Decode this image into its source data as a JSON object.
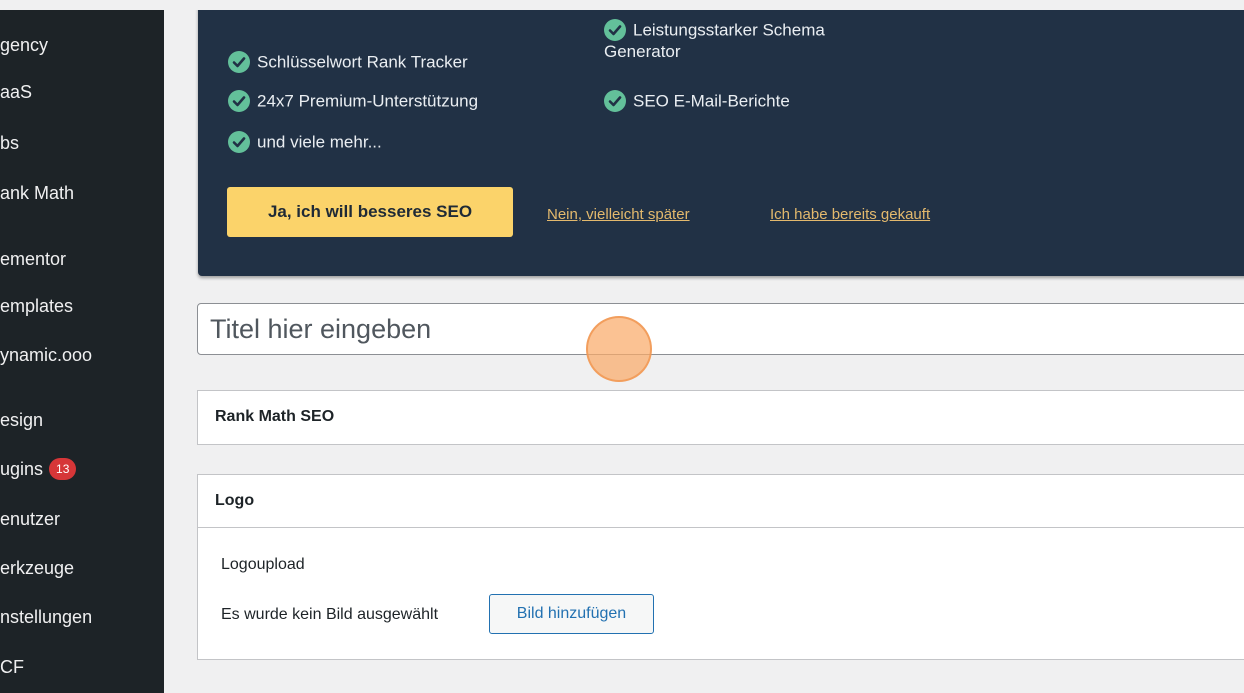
{
  "sidebar": {
    "items": [
      {
        "label": "gency"
      },
      {
        "label": "aaS"
      },
      {
        "label": "bs"
      },
      {
        "label": "ank Math"
      },
      {
        "label": "ementor"
      },
      {
        "label": "emplates"
      },
      {
        "label": "ynamic.ooo"
      },
      {
        "label": "esign"
      },
      {
        "label": "ugins",
        "badge": "13"
      },
      {
        "label": "enutzer"
      },
      {
        "label": "erkzeuge"
      },
      {
        "label": "nstellungen"
      },
      {
        "label": "CF"
      }
    ]
  },
  "promo": {
    "features": [
      {
        "label": "Schlüsselwort Rank Tracker"
      },
      {
        "label": "Leistungsstarker Schema",
        "label_line2": "Generator"
      },
      {
        "label": "24x7 Premium-Unterstützung"
      },
      {
        "label": "SEO E-Mail-Berichte"
      },
      {
        "label": "und viele mehr..."
      }
    ],
    "cta_label": "Ja, ich will besseres SEO",
    "later_link": "Nein, vielleicht später",
    "bought_link": "Ich habe bereits gekauft",
    "colors": {
      "background": "#213145",
      "cta": "#fbd36a",
      "check": "#63c09a",
      "link": "#e3b96d"
    }
  },
  "editor": {
    "title_placeholder": "Titel hier eingeben"
  },
  "rank_math_box": {
    "title": "Rank Math SEO"
  },
  "logo_box": {
    "title": "Logo",
    "field_label": "Logoupload",
    "no_image_text": "Es wurde kein Bild ausgewählt",
    "add_image_button": "Bild hinzufügen"
  }
}
